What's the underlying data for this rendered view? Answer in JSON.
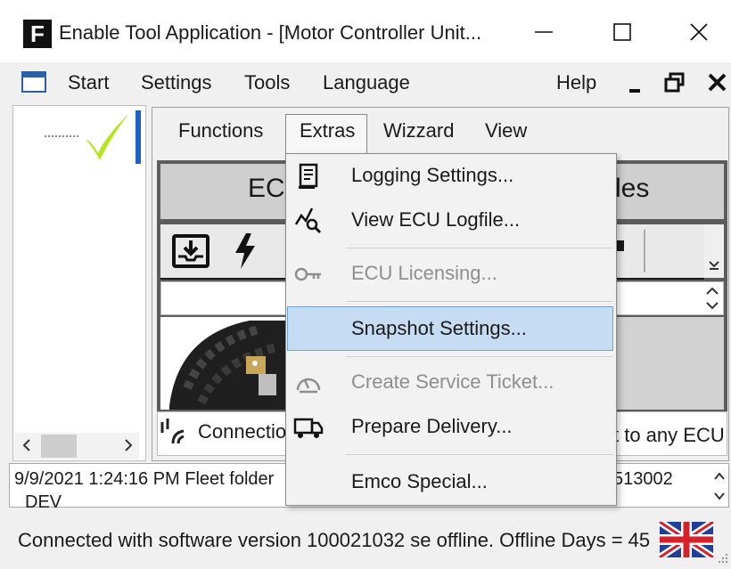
{
  "window": {
    "logo_letter": "F",
    "title": "Enable Tool Application - [Motor Controller Unit..."
  },
  "menubar": {
    "items": [
      {
        "label": "Start"
      },
      {
        "label": "Settings"
      },
      {
        "label": "Tools"
      },
      {
        "label": "Language"
      }
    ],
    "help_label": "Help"
  },
  "tabs": [
    {
      "label": "Functions"
    },
    {
      "label": "Extras",
      "active": true
    },
    {
      "label": "Wizzard"
    },
    {
      "label": "View"
    }
  ],
  "ecu_banner": {
    "left_text": "EC",
    "right_text": "les"
  },
  "dropdown": {
    "items": [
      {
        "label": "Logging Settings...",
        "icon": "log-document-icon",
        "enabled": true
      },
      {
        "label": "View ECU Logfile...",
        "icon": "chart-magnifier-icon",
        "enabled": true
      },
      {
        "label": "ECU Licensing...",
        "icon": "key-icon",
        "enabled": false
      },
      {
        "label": "Snapshot Settings...",
        "icon": "",
        "enabled": true,
        "highlighted": true
      },
      {
        "label": "Create Service Ticket...",
        "icon": "gauge-icon",
        "enabled": false
      },
      {
        "label": "Prepare Delivery...",
        "icon": "truck-icon",
        "enabled": true
      },
      {
        "label": "Emco Special...",
        "icon": "",
        "enabled": true
      }
    ]
  },
  "connection": {
    "label": "Connectio",
    "right_text": "t to any ECU"
  },
  "log": {
    "line1": "9/9/2021 1:24:16 PM Fleet folder",
    "line2": "DEV",
    "right_text": "513002"
  },
  "status": {
    "text": "Connected with software version 100021032 se offline. Offline Days = 45"
  },
  "colors": {
    "check": "#b5e61d",
    "selection_blue": "#1a63c4",
    "highlight_bg": "#c6dcf3",
    "highlight_border": "#6fa3d8"
  }
}
